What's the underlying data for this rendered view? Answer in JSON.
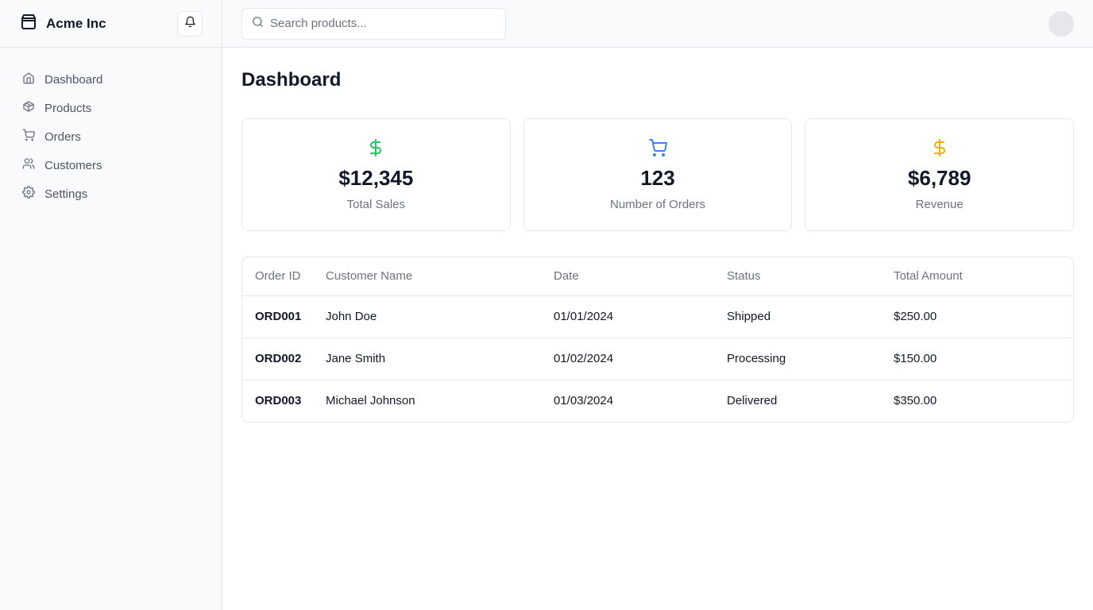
{
  "brand": {
    "name": "Acme Inc"
  },
  "sidebar": {
    "items": [
      {
        "label": "Dashboard",
        "icon": "home-icon"
      },
      {
        "label": "Products",
        "icon": "package-icon"
      },
      {
        "label": "Orders",
        "icon": "cart-icon"
      },
      {
        "label": "Customers",
        "icon": "users-icon"
      },
      {
        "label": "Settings",
        "icon": "gear-icon"
      }
    ]
  },
  "search": {
    "placeholder": "Search products...",
    "value": ""
  },
  "page": {
    "title": "Dashboard"
  },
  "stats": [
    {
      "value": "$12,345",
      "label": "Total Sales",
      "icon": "dollar-icon",
      "color": "#22c55e"
    },
    {
      "value": "123",
      "label": "Number of Orders",
      "icon": "cart-icon",
      "color": "#3b82f6"
    },
    {
      "value": "$6,789",
      "label": "Revenue",
      "icon": "dollar-icon",
      "color": "#eab308"
    }
  ],
  "orders": {
    "columns": [
      "Order ID",
      "Customer Name",
      "Date",
      "Status",
      "Total Amount"
    ],
    "rows": [
      {
        "id": "ORD001",
        "customer": "John Doe",
        "date": "01/01/2024",
        "status": "Shipped",
        "total": "$250.00"
      },
      {
        "id": "ORD002",
        "customer": "Jane Smith",
        "date": "01/02/2024",
        "status": "Processing",
        "total": "$150.00"
      },
      {
        "id": "ORD003",
        "customer": "Michael Johnson",
        "date": "01/03/2024",
        "status": "Delivered",
        "total": "$350.00"
      }
    ]
  }
}
